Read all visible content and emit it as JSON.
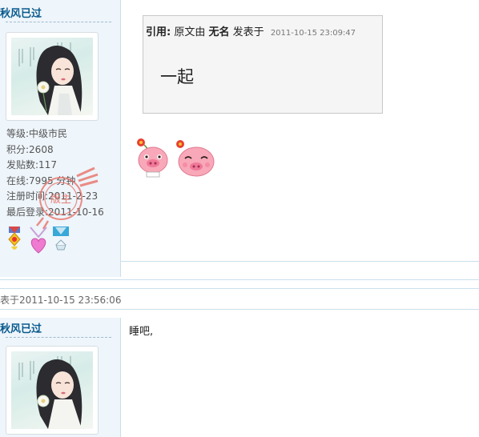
{
  "post1": {
    "username": "秋风已过",
    "stats": [
      "等级:中级市民",
      "积分:2608",
      "发贴数:117",
      "在线:7995 分钟",
      "注册时间:2011-2-23",
      "最后登录:2011-10-16"
    ],
    "badge_text": "版主",
    "quote": {
      "label": "引用:",
      "prefix": "原文由",
      "author": "无名",
      "posted": "发表于",
      "time": "2011-10-15 23:09:47",
      "body": "一起"
    }
  },
  "post2": {
    "header": "表于2011-10-15 23:56:06",
    "username": "秋风已过",
    "body": "睡吧,"
  },
  "colors": {
    "username": "#08598c",
    "sidebar_bg": "#eef5fb",
    "divider": "#c9e0ee",
    "quote_bg": "#f5f5f5"
  },
  "icons": [
    "avatar-illustration",
    "moderator-stamp",
    "medal-icon",
    "heart-medal-icon",
    "diamond-medal-icon",
    "pink-pig-emoji",
    "pink-pig-laughing-emoji"
  ]
}
